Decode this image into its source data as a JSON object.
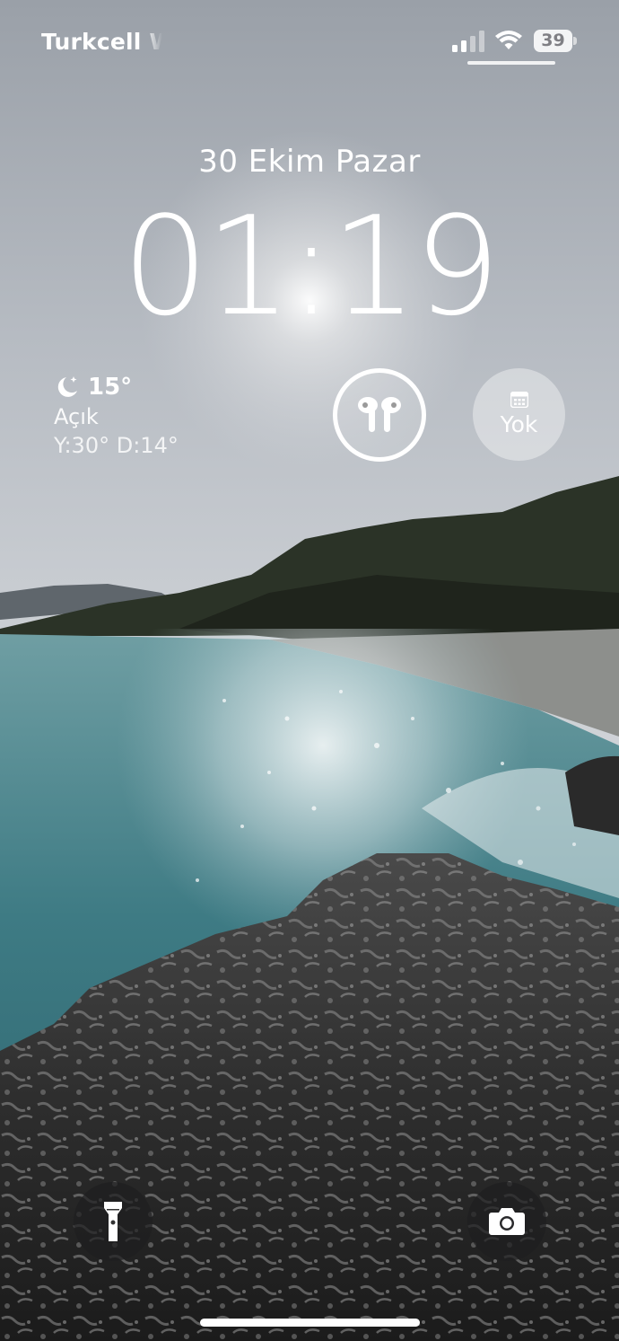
{
  "status_bar": {
    "carrier": "Turkcell Wi-Fi",
    "battery_level": "39"
  },
  "lock_screen": {
    "date": "30 Ekim Pazar",
    "time": "01:19"
  },
  "weather": {
    "temperature": "15°",
    "condition": "Açık",
    "high_low": "Y:30° D:14°",
    "icon": "moon-stars-icon"
  },
  "widgets": {
    "airpods_icon": "airpods-icon",
    "calendar_label": "Yok",
    "calendar_icon": "calendar-icon"
  },
  "quick_actions": {
    "flashlight_icon": "flashlight-icon",
    "camera_icon": "camera-icon"
  },
  "colors": {
    "text": "#ffffff",
    "button_bg": "#1e1e20"
  }
}
